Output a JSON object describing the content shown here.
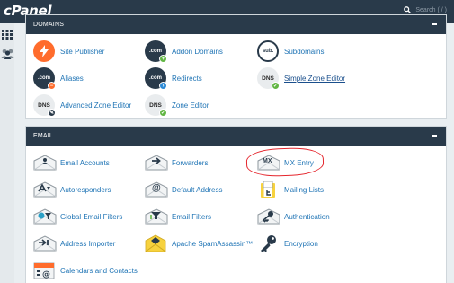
{
  "brand": {
    "logo_text": "cPanel",
    "accent": "#293a4a",
    "link_color": "#1f74b5"
  },
  "search": {
    "placeholder": "Search ( / )"
  },
  "sidenav": {
    "items": [
      {
        "icon": "grid-icon"
      },
      {
        "icon": "users-icon"
      }
    ]
  },
  "domains": {
    "title": "DOMAINS",
    "items": [
      {
        "label": "Site Publisher",
        "icon": "lightning-icon"
      },
      {
        "label": "Addon Domains",
        "icon": "com-plus-icon",
        "icon_text": ".com"
      },
      {
        "label": "Subdomains",
        "icon": "sub-icon",
        "icon_text": "sub."
      },
      {
        "label": "Aliases",
        "icon": "com-minus-icon",
        "icon_text": ".com"
      },
      {
        "label": "Redirects",
        "icon": "com-arrow-icon",
        "icon_text": ".com"
      },
      {
        "label": "Simple Zone Editor",
        "icon": "dns-check-icon",
        "icon_text": "DNS"
      },
      {
        "label": "Advanced Zone Editor",
        "icon": "dns-edit-icon",
        "icon_text": "DNS"
      },
      {
        "label": "Zone Editor",
        "icon": "dns-check-icon",
        "icon_text": "DNS"
      }
    ]
  },
  "email": {
    "title": "EMAIL",
    "items": [
      {
        "label": "Email Accounts",
        "icon": "email-accounts-icon"
      },
      {
        "label": "Forwarders",
        "icon": "forwarders-icon"
      },
      {
        "label": "MX Entry",
        "icon": "mx-entry-icon",
        "icon_text": "MX"
      },
      {
        "label": "Autoresponders",
        "icon": "autoresponders-icon"
      },
      {
        "label": "Default Address",
        "icon": "default-address-icon",
        "icon_text": "@"
      },
      {
        "label": "Mailing Lists",
        "icon": "mailing-lists-icon"
      },
      {
        "label": "Global Email Filters",
        "icon": "global-filters-icon"
      },
      {
        "label": "Email Filters",
        "icon": "email-filters-icon"
      },
      {
        "label": "Authentication",
        "icon": "authentication-icon"
      },
      {
        "label": "Address Importer",
        "icon": "address-importer-icon"
      },
      {
        "label": "Apache SpamAssassin™",
        "icon": "spamassassin-icon"
      },
      {
        "label": "Encryption",
        "icon": "key-icon"
      },
      {
        "label": "Calendars and Contacts",
        "icon": "calendar-icon"
      }
    ]
  }
}
